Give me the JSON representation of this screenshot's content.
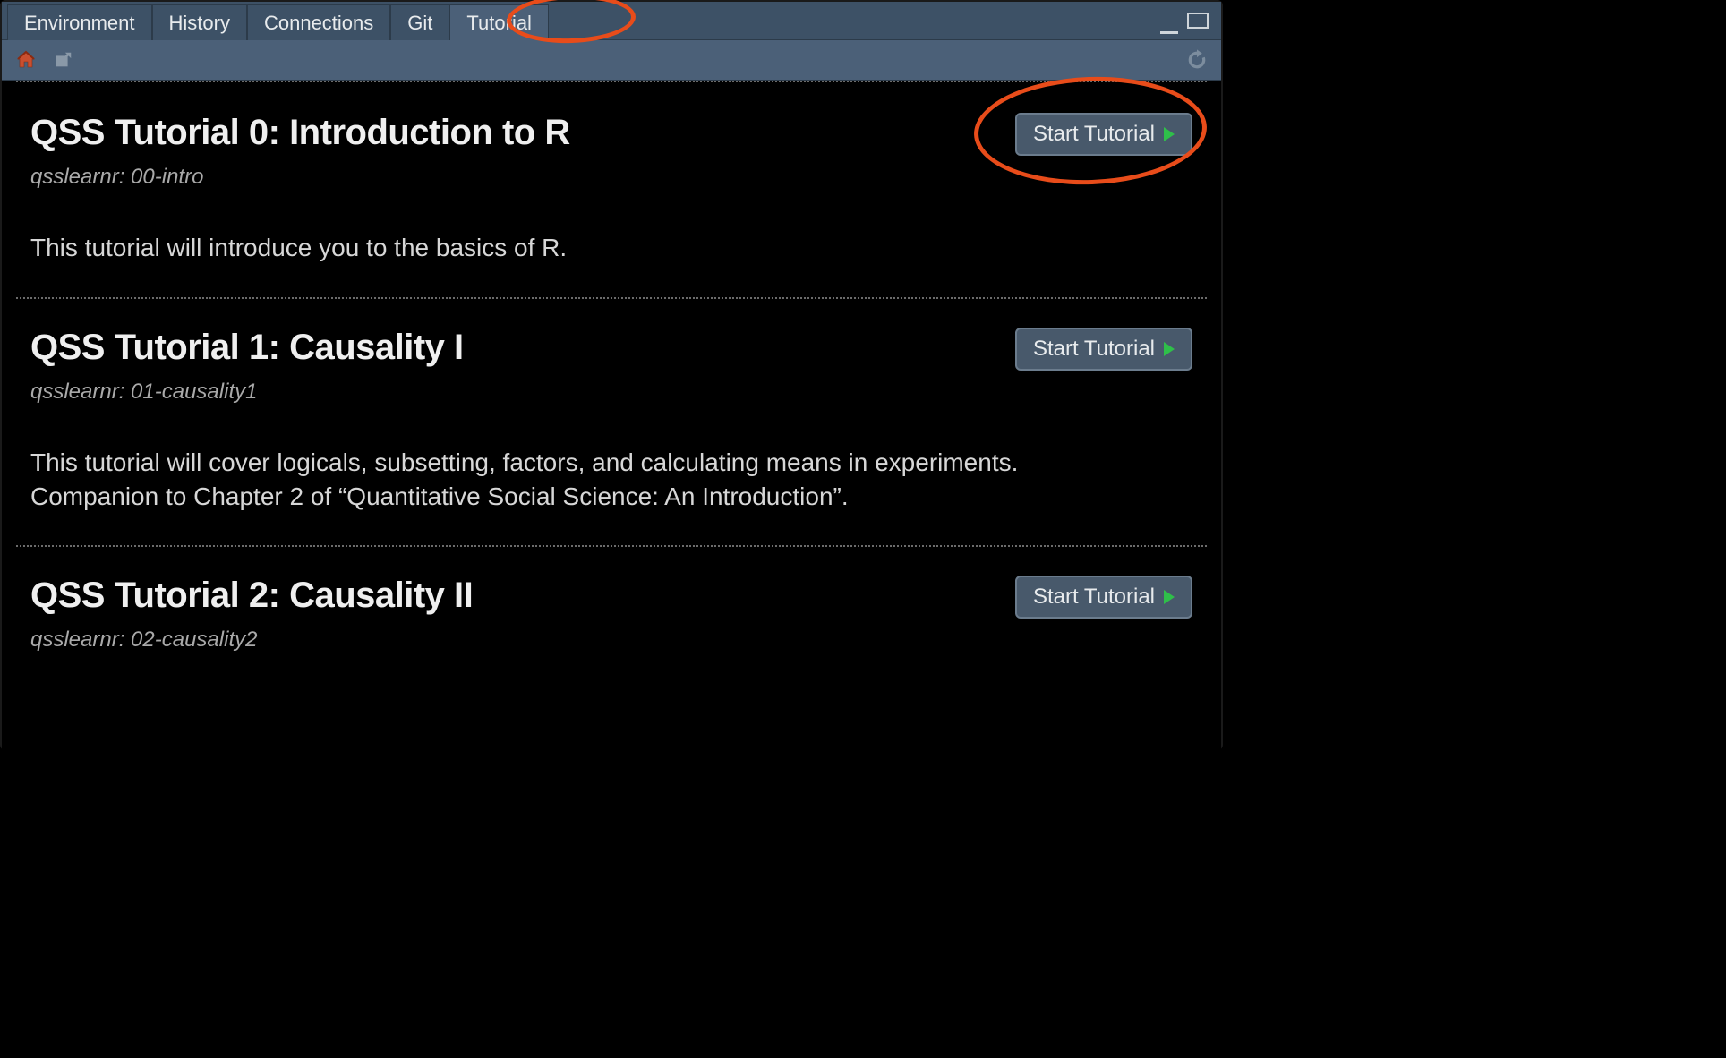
{
  "tabs": {
    "environment": "Environment",
    "history": "History",
    "connections": "Connections",
    "git": "Git",
    "tutorial": "Tutorial"
  },
  "buttons": {
    "start": "Start Tutorial"
  },
  "tutorials": [
    {
      "title": "QSS Tutorial 0: Introduction to R",
      "source": "qsslearnr: 00-intro",
      "description": "This tutorial will introduce you to the basics of R."
    },
    {
      "title": "QSS Tutorial 1: Causality I",
      "source": "qsslearnr: 01-causality1",
      "description": "This tutorial will cover logicals, subsetting, factors, and calculating means in experiments. Companion to Chapter 2 of “Quantitative Social Science: An Introduction”."
    },
    {
      "title": "QSS Tutorial 2: Causality II",
      "source": "qsslearnr: 02-causality2",
      "description": ""
    }
  ]
}
